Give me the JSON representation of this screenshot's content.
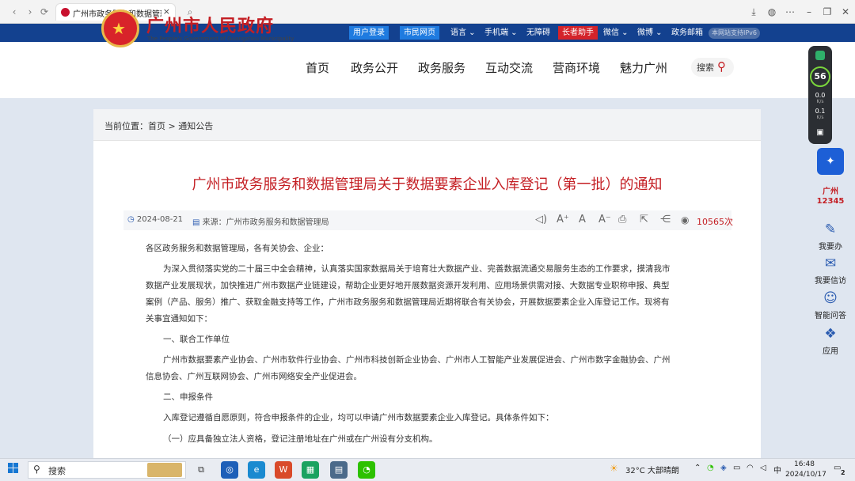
{
  "browser": {
    "tab_title": "广州市政务服务和数据管理局",
    "close": "×"
  },
  "topbar": {
    "login": "用户登录",
    "citizen": "市民网页",
    "language": "语言",
    "mobile": "手机端",
    "accessible": "无障碍",
    "elder": "长者助手",
    "wechat": "微信",
    "weibo": "微博",
    "mail": "政务邮箱",
    "ipv6": "本网站支持IPv6"
  },
  "header": {
    "site_name": "广州市人民政府",
    "site_en": "The People's Government of Guangzhou Municipality",
    "nav": [
      "首页",
      "政务公开",
      "政务服务",
      "互动交流",
      "营商环境",
      "魅力广州"
    ],
    "search": "搜索"
  },
  "breadcrumb": {
    "prefix": "当前位置：",
    "home": "首页",
    "sep": ">",
    "current": "通知公告"
  },
  "article": {
    "title": "广州市政务服务和数据管理局关于数据要素企业入库登记（第一批）的通知",
    "date": "2024-08-21",
    "source_label": "来源：",
    "source": "广州市政务服务和数据管理局",
    "views": "10565次",
    "paragraphs": [
      "各区政务服务和数据管理局，各有关协会、企业：",
      "为深入贯彻落实党的二十届三中全会精神，认真落实国家数据局关于培育壮大数据产业、完善数据流通交易服务生态的工作要求，摸清我市",
      "数据产业发展现状，加快推进广州市数据产业链建设，帮助企业更好地开展数据资源开发利用、应用场景供需对接、大数据专业职称申报、典型",
      "案例（产品、服务）推广、获取金融支持等工作，广州市政务服务和数据管理局近期将联合有关协会，开展数据要素企业入库登记工作。现将有",
      "关事宜通知如下：",
      "一、联合工作单位",
      "广州市数据要素产业协会、广州市软件行业协会、广州市科技创新企业协会、广州市人工智能产业发展促进会、广州市数字金融协会、广州",
      "信息协会、广州互联网协会、广州市网络安全产业促进会。",
      "二、申报条件",
      "入库登记遵循自愿原则，符合申报条件的企业，均可以申请广州市数据要素企业入库登记。具体条件如下：",
      "（一）应具备独立法人资格，登记注册地址在广州或在广州设有分支机构。"
    ]
  },
  "widget": {
    "score": "56",
    "up": "0.0",
    "down": "0.1",
    "unit": "K/s"
  },
  "sidebar": {
    "hotline_city": "广州",
    "hotline": "12345",
    "items": [
      "我要办",
      "我要信访",
      "智能问答",
      "应用"
    ]
  },
  "taskbar": {
    "search": "搜索",
    "weather": "32°C  大部晴朗",
    "ime": "中",
    "time": "16:48",
    "date": "2024/10/17",
    "notif": "2"
  }
}
